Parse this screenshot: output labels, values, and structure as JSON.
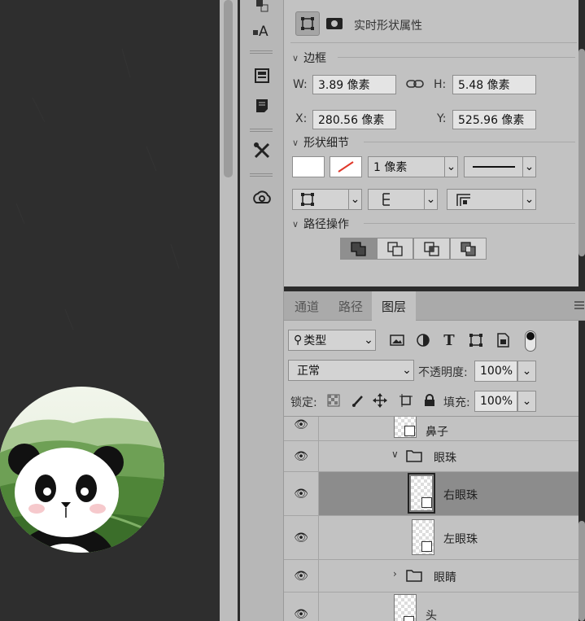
{
  "props_panel": {
    "title": "实时形状属性",
    "bounds_section": "边框",
    "w_label": "W:",
    "w_value": "3.89 像素",
    "h_label": "H:",
    "h_value": "5.48 像素",
    "x_label": "X:",
    "x_value": "280.56 像素",
    "y_label": "Y:",
    "y_value": "525.96 像素",
    "shape_section": "形状细节",
    "stroke_width": "1 像素",
    "path_ops_section": "路径操作"
  },
  "tabs": [
    "通道",
    "路径",
    "图层"
  ],
  "active_tab": "图层",
  "layers_panel": {
    "filter_kind": "类型",
    "blend_mode": "正常",
    "opacity_label": "不透明度:",
    "opacity_value": "100%",
    "lock_label": "锁定:",
    "fill_label": "填充:",
    "fill_value": "100%"
  },
  "layers": [
    {
      "name": "鼻子",
      "type": "shape",
      "selected": false
    },
    {
      "name": "眼珠",
      "type": "group",
      "expanded": true,
      "selected": false
    },
    {
      "name": "右眼珠",
      "type": "shape",
      "selected": true
    },
    {
      "name": "左眼珠",
      "type": "shape",
      "selected": false
    },
    {
      "name": "眼睛",
      "type": "group",
      "expanded": false,
      "selected": false
    },
    {
      "name": "头",
      "type": "shape",
      "selected": false
    }
  ],
  "colors": {
    "panel_bg": "#c2c2c2",
    "selected_row": "#8c8c8c",
    "canvas_bg": "#2e2e2e"
  }
}
